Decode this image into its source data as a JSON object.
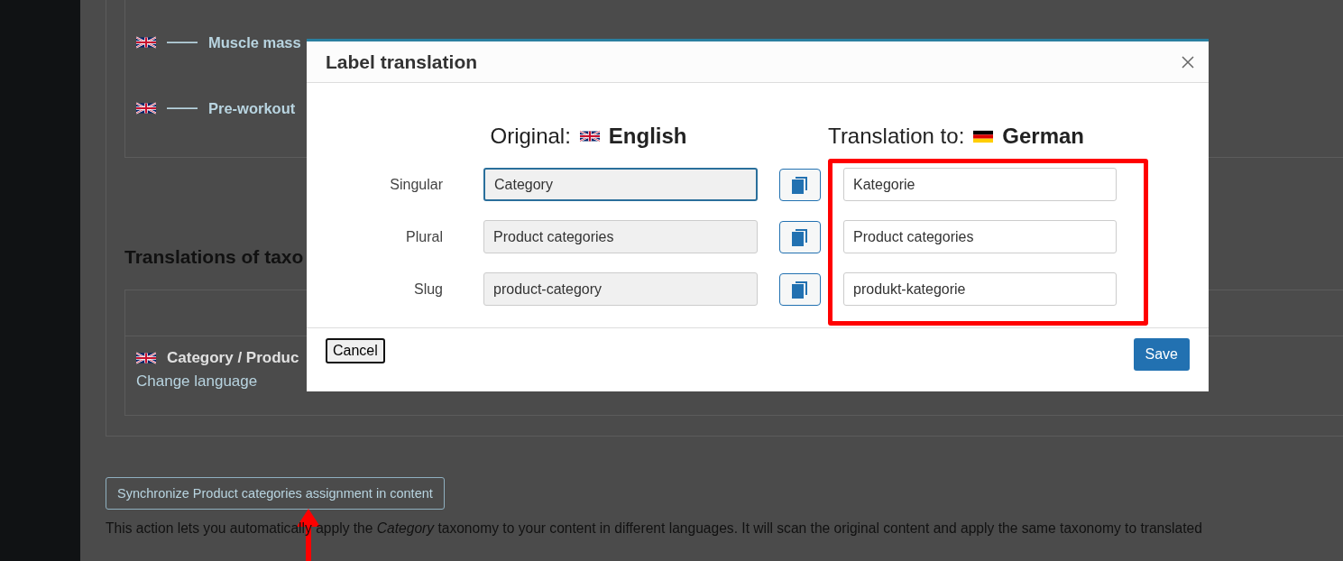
{
  "background": {
    "rows": [
      {
        "prefix": "——",
        "label": "Muscle mass"
      },
      {
        "prefix": "——",
        "label": "Pre-workout"
      }
    ],
    "heading": "Translations of taxo",
    "term": {
      "label": "Category / Produc",
      "link": "Change language"
    },
    "sync_button": "Synchronize Product categories assignment in content",
    "description": "This action lets you automatically apply the *Category* taxonomy to your content in different languages. It will scan the original content and apply the same taxonomy to translated"
  },
  "dialog": {
    "title": "Label translation",
    "original": {
      "label": "Original:",
      "language": "English"
    },
    "translation": {
      "label": "Translation to:",
      "language": "German"
    },
    "rows": [
      {
        "label": "Singular",
        "original": "Category",
        "translation": "Kategorie",
        "focused": true
      },
      {
        "label": "Plural",
        "original": "Product categories",
        "translation": "Product categories",
        "focused": false
      },
      {
        "label": "Slug",
        "original": "product-category",
        "translation": "produkt-kategorie",
        "focused": false
      }
    ],
    "cancel": "Cancel",
    "save": "Save"
  }
}
